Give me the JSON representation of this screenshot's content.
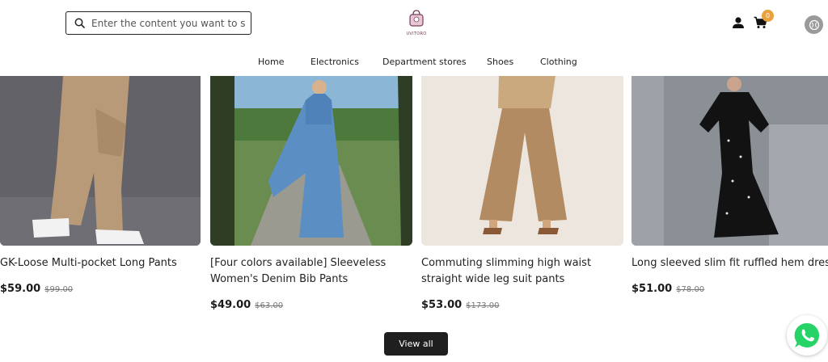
{
  "header": {
    "search_placeholder": "Enter the content you want to se",
    "logo_text": "UVITORO",
    "cart_count": "0",
    "icons": {
      "search": "search-icon",
      "user": "user-icon",
      "cart": "cart-icon",
      "language": "language-icon"
    }
  },
  "nav": {
    "items": [
      {
        "label": "Home"
      },
      {
        "label": "Electronics"
      },
      {
        "label": "Department stores"
      },
      {
        "label": "Shoes"
      },
      {
        "label": "Clothing"
      }
    ]
  },
  "products": [
    {
      "title": "GK-Loose Multi-pocket Long Pants",
      "price": "$59.00",
      "old_price": "$99.00"
    },
    {
      "title": "[Four colors available] Sleeveless Women's Denim Bib Pants",
      "price": "$49.00",
      "old_price": "$63.00"
    },
    {
      "title": "Commuting slimming high waist straight wide leg suit pants",
      "price": "$53.00",
      "old_price": "$173.00"
    },
    {
      "title": "Long sleeved slim fit ruffled hem dress",
      "price": "$51.00",
      "old_price": "$78.00"
    }
  ],
  "view_all_label": "View all",
  "colors": {
    "accent": "#e8a13c",
    "button_bg": "#1f1f1f",
    "whatsapp": "#25d366"
  }
}
